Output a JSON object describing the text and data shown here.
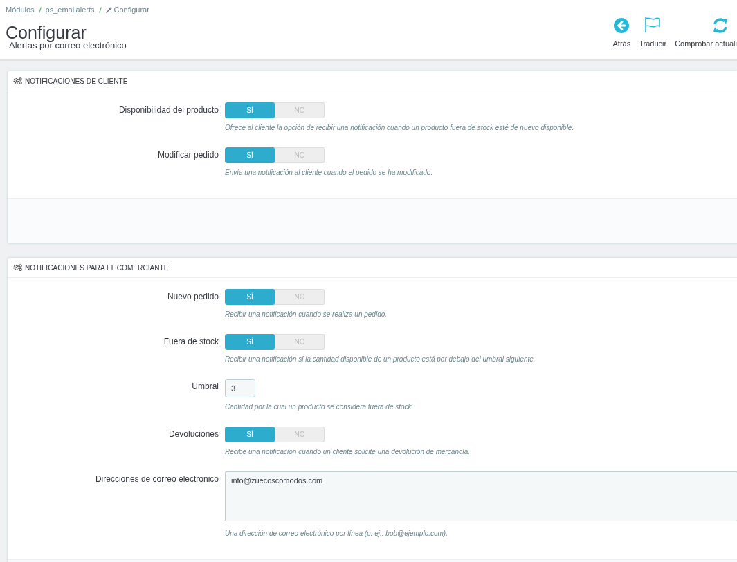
{
  "breadcrumb": [
    {
      "label": "Módulos",
      "kind": "link"
    },
    {
      "label": "ps_emailalerts",
      "kind": "link"
    },
    {
      "label": "Configurar",
      "kind": "current"
    }
  ],
  "page_title": "Configurar",
  "page_subtitle": "Alertas por correo electrónico",
  "toolbar": [
    {
      "label": "Atrás",
      "kind": "back"
    },
    {
      "label": "Traducir",
      "kind": "translate"
    },
    {
      "label": "Comprobar actuali",
      "kind": "refresh"
    }
  ],
  "panels": [
    {
      "title": "NOTIFICACIONES DE CLIENTE",
      "fields": [
        {
          "kind": "switch",
          "label": "Disponibilidad del producto",
          "options": [
            {
              "label": "SÍ",
              "selected": true
            },
            {
              "label": "NO",
              "selected": false
            }
          ],
          "hint": "Ofrece al cliente la opción de recibir una notificación cuando un producto fuera de stock esté de nuevo disponible."
        },
        {
          "kind": "switch",
          "label": "Modificar pedido",
          "options": [
            {
              "label": "SÍ",
              "selected": true
            },
            {
              "label": "NO",
              "selected": false
            }
          ],
          "hint": "Envía una notificación al cliente cuando el pedido se ha modificado."
        }
      ]
    },
    {
      "title": "NOTIFICACIONES PARA EL COMERCIANTE",
      "fields": [
        {
          "kind": "switch",
          "label": "Nuevo pedido",
          "options": [
            {
              "label": "SÍ",
              "selected": true
            },
            {
              "label": "NO",
              "selected": false
            }
          ],
          "hint": "Recibir una notificación cuando se realiza un pedido."
        },
        {
          "kind": "switch",
          "label": "Fuera de stock",
          "options": [
            {
              "label": "SÍ",
              "selected": true
            },
            {
              "label": "NO",
              "selected": false
            }
          ],
          "hint": "Recibir una notificación si la cantidad disponible de un producto está por debajo del umbral siguiente."
        },
        {
          "kind": "number",
          "label": "Umbral",
          "value": "3",
          "hint": "Cantidad por la cual un producto se considera fuera de stock."
        },
        {
          "kind": "switch",
          "label": "Devoluciones",
          "options": [
            {
              "label": "SÍ",
              "selected": true
            },
            {
              "label": "NO",
              "selected": false
            }
          ],
          "hint": "Recibe una notificación cuando un cliente solicite una devolución de mercancía."
        },
        {
          "kind": "textarea",
          "label": "Direcciones de correo electrónico",
          "value": "info@zuecoscomodos.com",
          "hint": "Una dirección de correo electrónico por línea (p. ej.: bob@ejemplo.com)."
        }
      ]
    }
  ]
}
